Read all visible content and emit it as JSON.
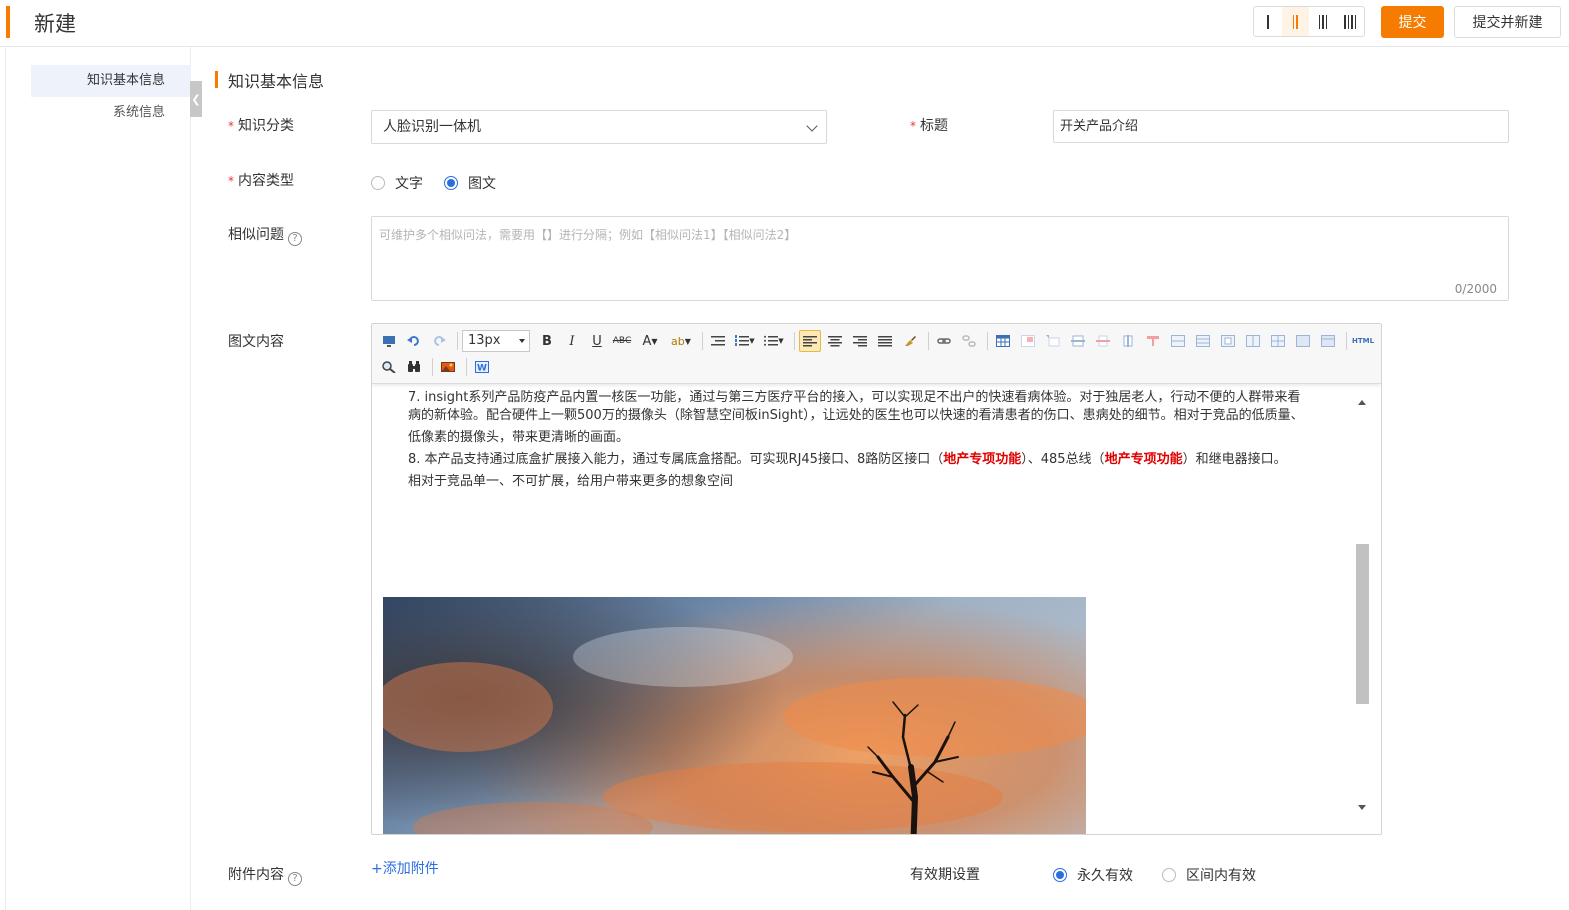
{
  "header": {
    "title": "新建",
    "layout_options": [
      "I",
      "II",
      "III",
      "IIII"
    ],
    "active_layout_index": 1,
    "submit_label": "提交",
    "submit_new_label": "提交并新建",
    "accent_color": "#f57c00"
  },
  "sidebar": {
    "items": [
      {
        "label": "知识基本信息",
        "active": true
      },
      {
        "label": "系统信息",
        "active": false
      }
    ],
    "collapse_icon": "chevron-left-icon"
  },
  "section": {
    "title": "知识基本信息"
  },
  "form": {
    "category": {
      "label": "知识分类",
      "required": true,
      "value": "人脸识别一体机"
    },
    "title": {
      "label": "标题",
      "required": true,
      "value": "开关产品介绍"
    },
    "content_type": {
      "label": "内容类型",
      "required": true,
      "options": [
        {
          "label": "文字",
          "checked": false
        },
        {
          "label": "图文",
          "checked": true
        }
      ]
    },
    "similar": {
      "label": "相似问题",
      "placeholder": "可维护多个相似问法，需要用【】进行分隔；例如【相似问法1】【相似问法2】",
      "counter": "0/2000"
    },
    "rich_content": {
      "label": "图文内容"
    },
    "attachment": {
      "label": "附件内容",
      "add_label": "+添加附件"
    },
    "validity": {
      "label": "有效期设置",
      "options": [
        {
          "label": "永久有效",
          "checked": true
        },
        {
          "label": "区间内有效",
          "checked": false
        }
      ]
    }
  },
  "editor": {
    "font_size": "13px",
    "toolbar_row1": [
      "preview-icon",
      "undo-icon",
      "redo-icon",
      "bold-icon",
      "italic-icon",
      "underline-icon",
      "strikethrough-icon",
      "font-color-icon",
      "highlight-icon",
      "indent-icon",
      "ordered-list-icon",
      "unordered-list-icon",
      "align-left-icon",
      "align-center-icon",
      "align-right-icon",
      "justify-icon",
      "clear-format-icon",
      "link-icon",
      "unlink-icon",
      "table-icon",
      "html-source-icon"
    ],
    "toolbar_row2": [
      "search-replace-icon",
      "find-icon",
      "image-icon",
      "word-import-icon"
    ],
    "lines": {
      "l0": "7.   insight系列产品防疫产品内置一核医一功能，通过与第三方医疗平台的接入，可以实现足不出户的快速看病体验。对于独居老人，行动不便的人群带来看",
      "l1": "病的新体验。配合硬件上一颗500万的摄像头（除智慧空间板inSight），让远处的医生也可以快速的看清患者的伤口、患病处的细节。相对于竞品的低质量、",
      "l2": "低像素的摄像头，带来更清晰的画面。",
      "l3a": "8.   本产品支持通过底盒扩展接入能力，通过专属底盒搭配。可实现RJ45接口、8路防区接口（",
      "l3b": "地产专项功能",
      "l3c": "）、485总线（",
      "l3d": "地产专项功能",
      "l3e": "）和继电器接口。",
      "l4": "相对于竞品单一、不可扩展，给用户带来更多的想象空间"
    },
    "image_alt": "sunset-tree-photo"
  }
}
